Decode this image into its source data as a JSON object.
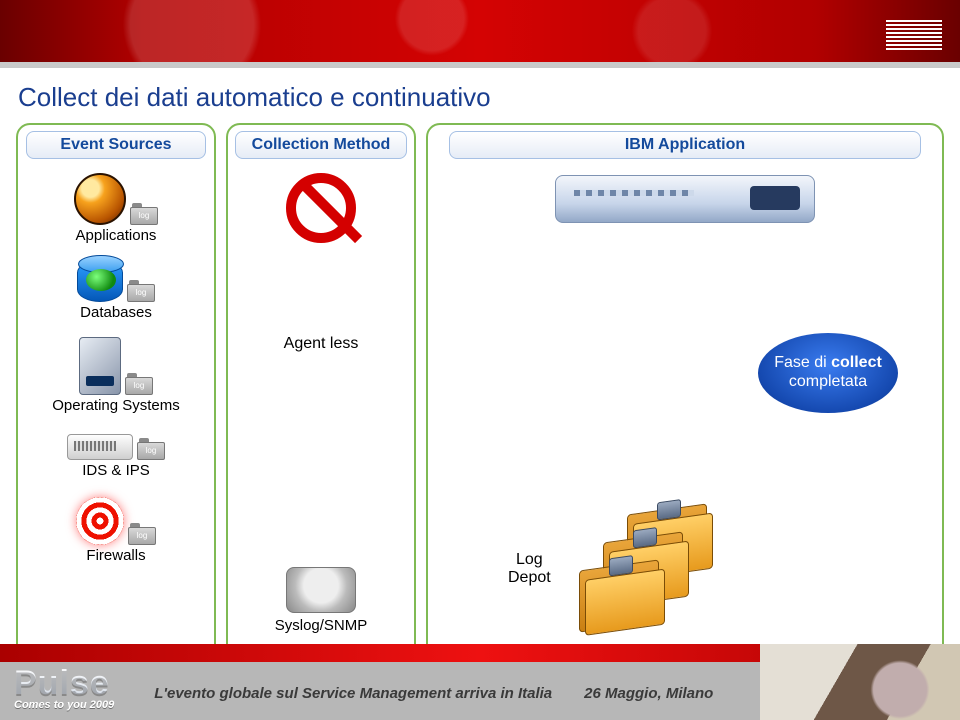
{
  "title": "Collect dei dati automatico e continuativo",
  "columns": {
    "sources": {
      "header": "Event Sources",
      "items": [
        {
          "label": "Applications",
          "log_text": "log"
        },
        {
          "label": "Databases",
          "log_text": "log"
        },
        {
          "label": "Operating Systems",
          "log_text": "log"
        },
        {
          "label": "IDS & IPS",
          "log_text": "log"
        },
        {
          "label": "Firewalls",
          "log_text": "log"
        }
      ]
    },
    "method": {
      "header": "Collection Method",
      "agentless_label": "Agent less",
      "syslog_label": "Syslog/SNMP"
    },
    "app": {
      "header": "IBM Application",
      "phase_line1": "Fase di collect",
      "phase_line2": "completata",
      "logdepot_line1": "Log",
      "logdepot_line2": "Depot"
    }
  },
  "footer": {
    "brand": "Pulse",
    "brand_sub": "Comes to you 2009",
    "tagline": "L'evento globale sul Service Management arriva in Italia",
    "date": "26 Maggio, Milano"
  }
}
